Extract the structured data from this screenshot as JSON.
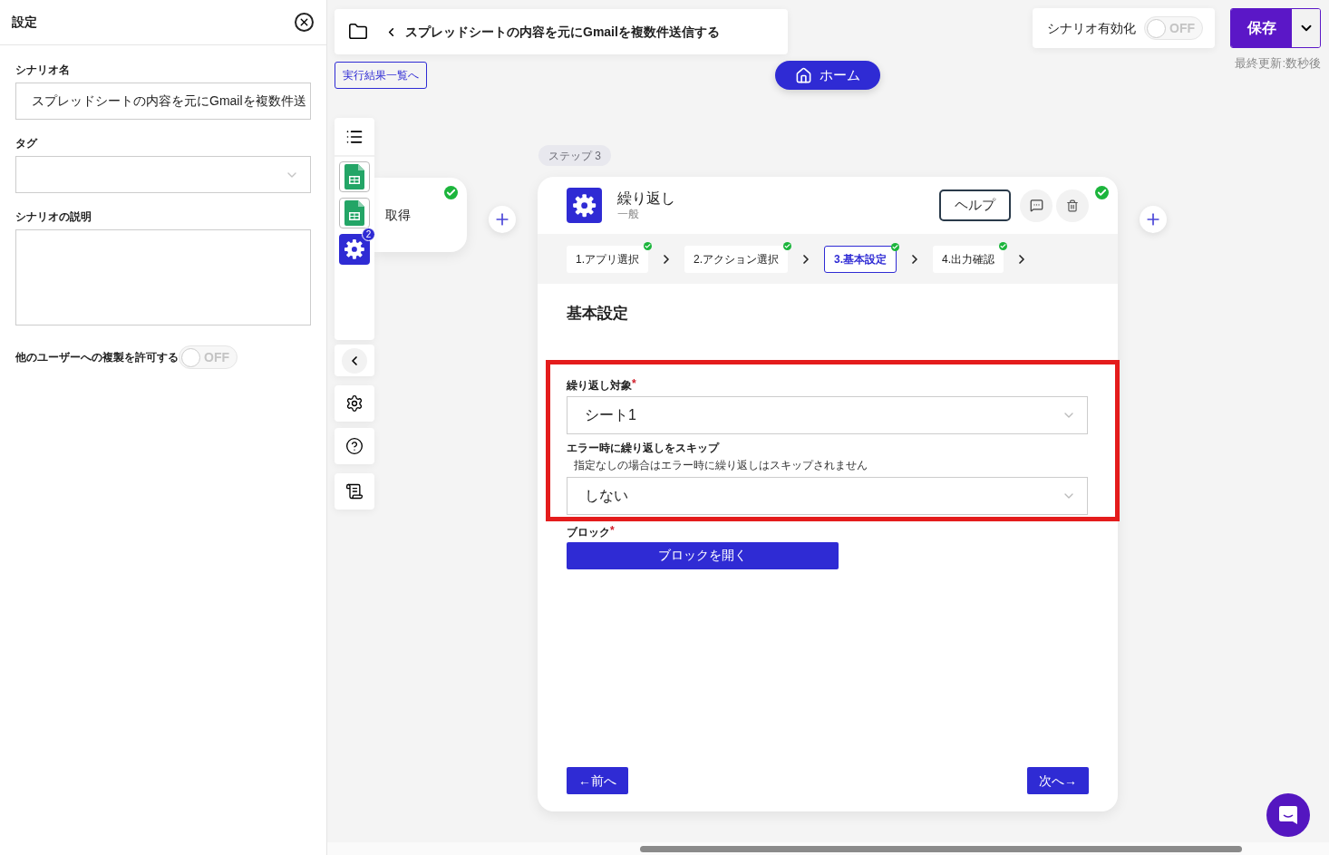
{
  "settings_panel": {
    "title": "設定",
    "fields": [
      {
        "kind": "text",
        "label": "シナリオ名",
        "value": "スプレッドシートの内容を元にGmailを複数件送"
      },
      {
        "kind": "select",
        "label": "タグ"
      },
      {
        "kind": "textarea",
        "label": "シナリオの説明"
      }
    ],
    "allow_copy": {
      "label": "他のユーザーへの複製を許可する",
      "on": false,
      "state_text": "OFF"
    }
  },
  "header": {
    "scenario_title": "スプレッドシートの内容を元にGmailを複数件送信する",
    "results_link": "実行結果一覧へ",
    "home_button": "ホーム",
    "enable": {
      "label": "シナリオ有効化",
      "on": false,
      "state_text": "OFF"
    },
    "save_button": "保存",
    "last_updated": "最終更新:数秒後"
  },
  "toolbar": {
    "steps": [
      {
        "kind": "sheet"
      },
      {
        "kind": "sheet"
      },
      {
        "kind": "gear",
        "badge": "2"
      }
    ]
  },
  "prev_node": {
    "text": "取得",
    "done": true
  },
  "step_label": "ステップ 3",
  "step_card": {
    "title": "繰り返し",
    "subtitle": "一般",
    "help_button": "ヘルプ",
    "done": true,
    "tabs": [
      {
        "label": "1.アプリ選択",
        "done": true,
        "selected": false
      },
      {
        "label": "2.アクション選択",
        "done": true,
        "selected": false
      },
      {
        "label": "3.基本設定",
        "done": true,
        "selected": true
      },
      {
        "label": "4.出力確認",
        "done": true,
        "selected": false
      }
    ],
    "section_title": "基本設定",
    "required_mark": "*",
    "fields": [
      {
        "label": "繰り返し対象",
        "required": true,
        "value": "シート1",
        "highlighted": true
      },
      {
        "label": "エラー時に繰り返しをスキップ",
        "required": false,
        "hint": "指定なしの場合はエラー時に繰り返しはスキップされません",
        "value": "しない",
        "highlighted": true
      }
    ],
    "block": {
      "label": "ブロック",
      "required": true,
      "button": "ブロックを開く"
    },
    "prev_button": "←前へ",
    "next_button": "次へ→"
  }
}
